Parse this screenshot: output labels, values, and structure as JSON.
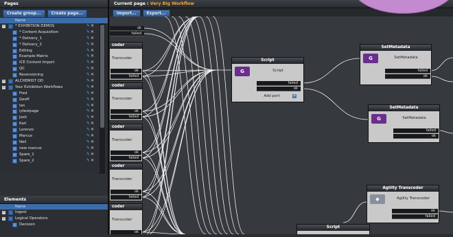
{
  "pages_panel": {
    "title": "Pages",
    "buttons": [
      "Create group...",
      "Create page..."
    ],
    "column_header": "Name",
    "items": [
      {
        "label": "* EXHIBITION DEMOS",
        "level": 0,
        "group": true
      },
      {
        "label": "* Content Acquisition",
        "level": 1
      },
      {
        "label": "* Delivery_1",
        "level": 1
      },
      {
        "label": "* Delivery_2",
        "level": 1
      },
      {
        "label": "Editing",
        "level": 1
      },
      {
        "label": "Example Matrix",
        "level": 1
      },
      {
        "label": "ICE Content Import",
        "level": 1
      },
      {
        "label": "QC",
        "level": 1
      },
      {
        "label": "Reversioning",
        "level": 1
      },
      {
        "label": "ALCHEMIST OD",
        "level": 0,
        "group": true
      },
      {
        "label": "Your Exhibition Workflows",
        "level": 0,
        "group": true
      },
      {
        "label": "Fred",
        "level": 1
      },
      {
        "label": "Geoff",
        "level": 1
      },
      {
        "label": "Ian",
        "level": 1
      },
      {
        "label": "iytestpage",
        "level": 1
      },
      {
        "label": "Josh",
        "level": 1
      },
      {
        "label": "Karl",
        "level": 1
      },
      {
        "label": "Lorenzo",
        "level": 1
      },
      {
        "label": "Marcus",
        "level": 1
      },
      {
        "label": "Neil",
        "level": 1
      },
      {
        "label": "new marcus",
        "level": 1
      },
      {
        "label": "Spare_1",
        "level": 1
      },
      {
        "label": "Spare_2",
        "level": 1
      }
    ],
    "edit_glyph": "✎",
    "delete_glyph": "✕"
  },
  "elements_panel": {
    "title": "Elements",
    "column_header": "Name",
    "items": [
      {
        "label": "Ingest",
        "level": 0,
        "group": true
      },
      {
        "label": "Logical Operators",
        "level": 0,
        "group": true
      },
      {
        "label": "Decision",
        "level": 1
      }
    ]
  },
  "main": {
    "current_page_label": "Current page :",
    "current_page_value": "Very Big Workflow",
    "buttons": [
      "Import...",
      "Export..."
    ]
  },
  "nodes": {
    "script_main": {
      "title": "Script",
      "body": "Script",
      "ports": [
        "failed",
        "ok"
      ],
      "add_port": "Add port"
    },
    "setmeta_1": {
      "title": "SetMetadata",
      "body": "SetMetadata",
      "ports": [
        "failed",
        "ok"
      ]
    },
    "setmeta_2": {
      "title": "SetMetadata",
      "body": "SetMetadata",
      "ports": [
        "failed",
        "ok"
      ]
    },
    "agility": {
      "title": "Agility Transcoder",
      "body": "Agility Transcoder",
      "ports": [
        "ok",
        "failed"
      ]
    },
    "script_bottom": {
      "title": "Script"
    },
    "transcoders": [
      {
        "title": "coder",
        "body": "Transcoder",
        "ports": [
          "ok",
          "failed"
        ]
      },
      {
        "title": "coder",
        "body": "Transcoder",
        "ports": [
          "ok",
          "failed"
        ]
      },
      {
        "title": "coder",
        "body": "Transcoder",
        "ports": [
          "ok",
          "failed"
        ]
      },
      {
        "title": "coder",
        "body": "Transcoder",
        "ports": [
          "ok",
          "failed"
        ]
      },
      {
        "title": "coder",
        "body": "Transcoder",
        "ports": [
          "ok"
        ]
      }
    ],
    "top_ports": [
      "ok",
      "failed"
    ]
  },
  "colors": {
    "accent_button": "#3d6da8",
    "current_page_value": "#f3a542",
    "node_header": "#2a2d31",
    "edit_icon": "#4da3ff",
    "decoration": "#c38ad0"
  }
}
